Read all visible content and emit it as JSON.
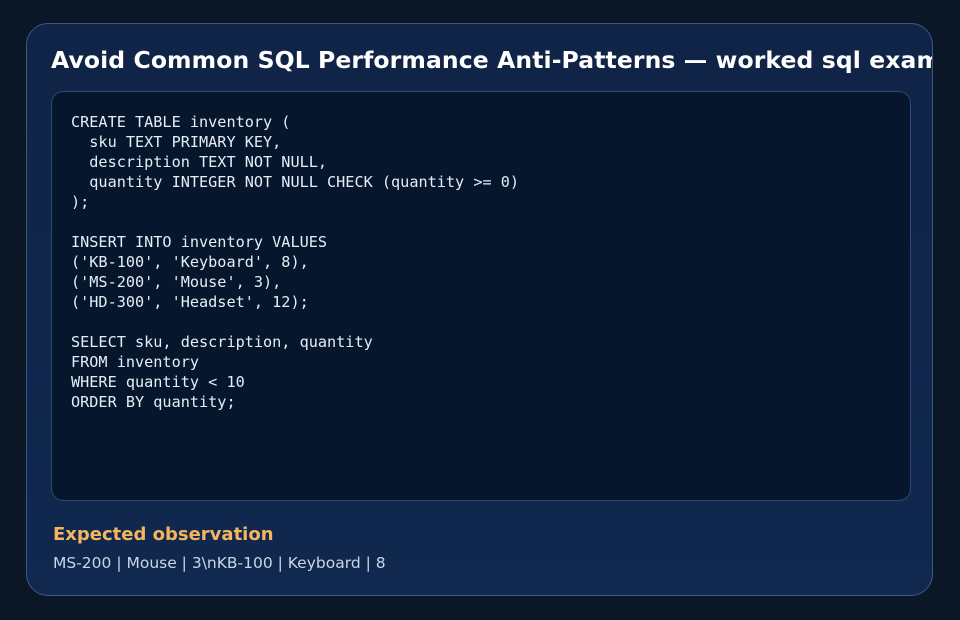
{
  "card": {
    "title": "Avoid Common SQL Performance Anti-Patterns — worked sql example"
  },
  "code": {
    "language": "sql",
    "text": "CREATE TABLE inventory (\n  sku TEXT PRIMARY KEY,\n  description TEXT NOT NULL,\n  quantity INTEGER NOT NULL CHECK (quantity >= 0)\n);\n\nINSERT INTO inventory VALUES\n('KB-100', 'Keyboard', 8),\n('MS-200', 'Mouse', 3),\n('HD-300', 'Headset', 12);\n\nSELECT sku, description, quantity\nFROM inventory\nWHERE quantity < 10\nORDER BY quantity;"
  },
  "observation": {
    "heading": "Expected observation",
    "text": "MS-200 | Mouse | 3\\nKB-100 | Keyboard | 8"
  },
  "colors": {
    "background": "#0b1627",
    "card": "#0f2446",
    "code_panel": "#06172d",
    "accent": "#f5b55c",
    "title": "#ffffff"
  }
}
